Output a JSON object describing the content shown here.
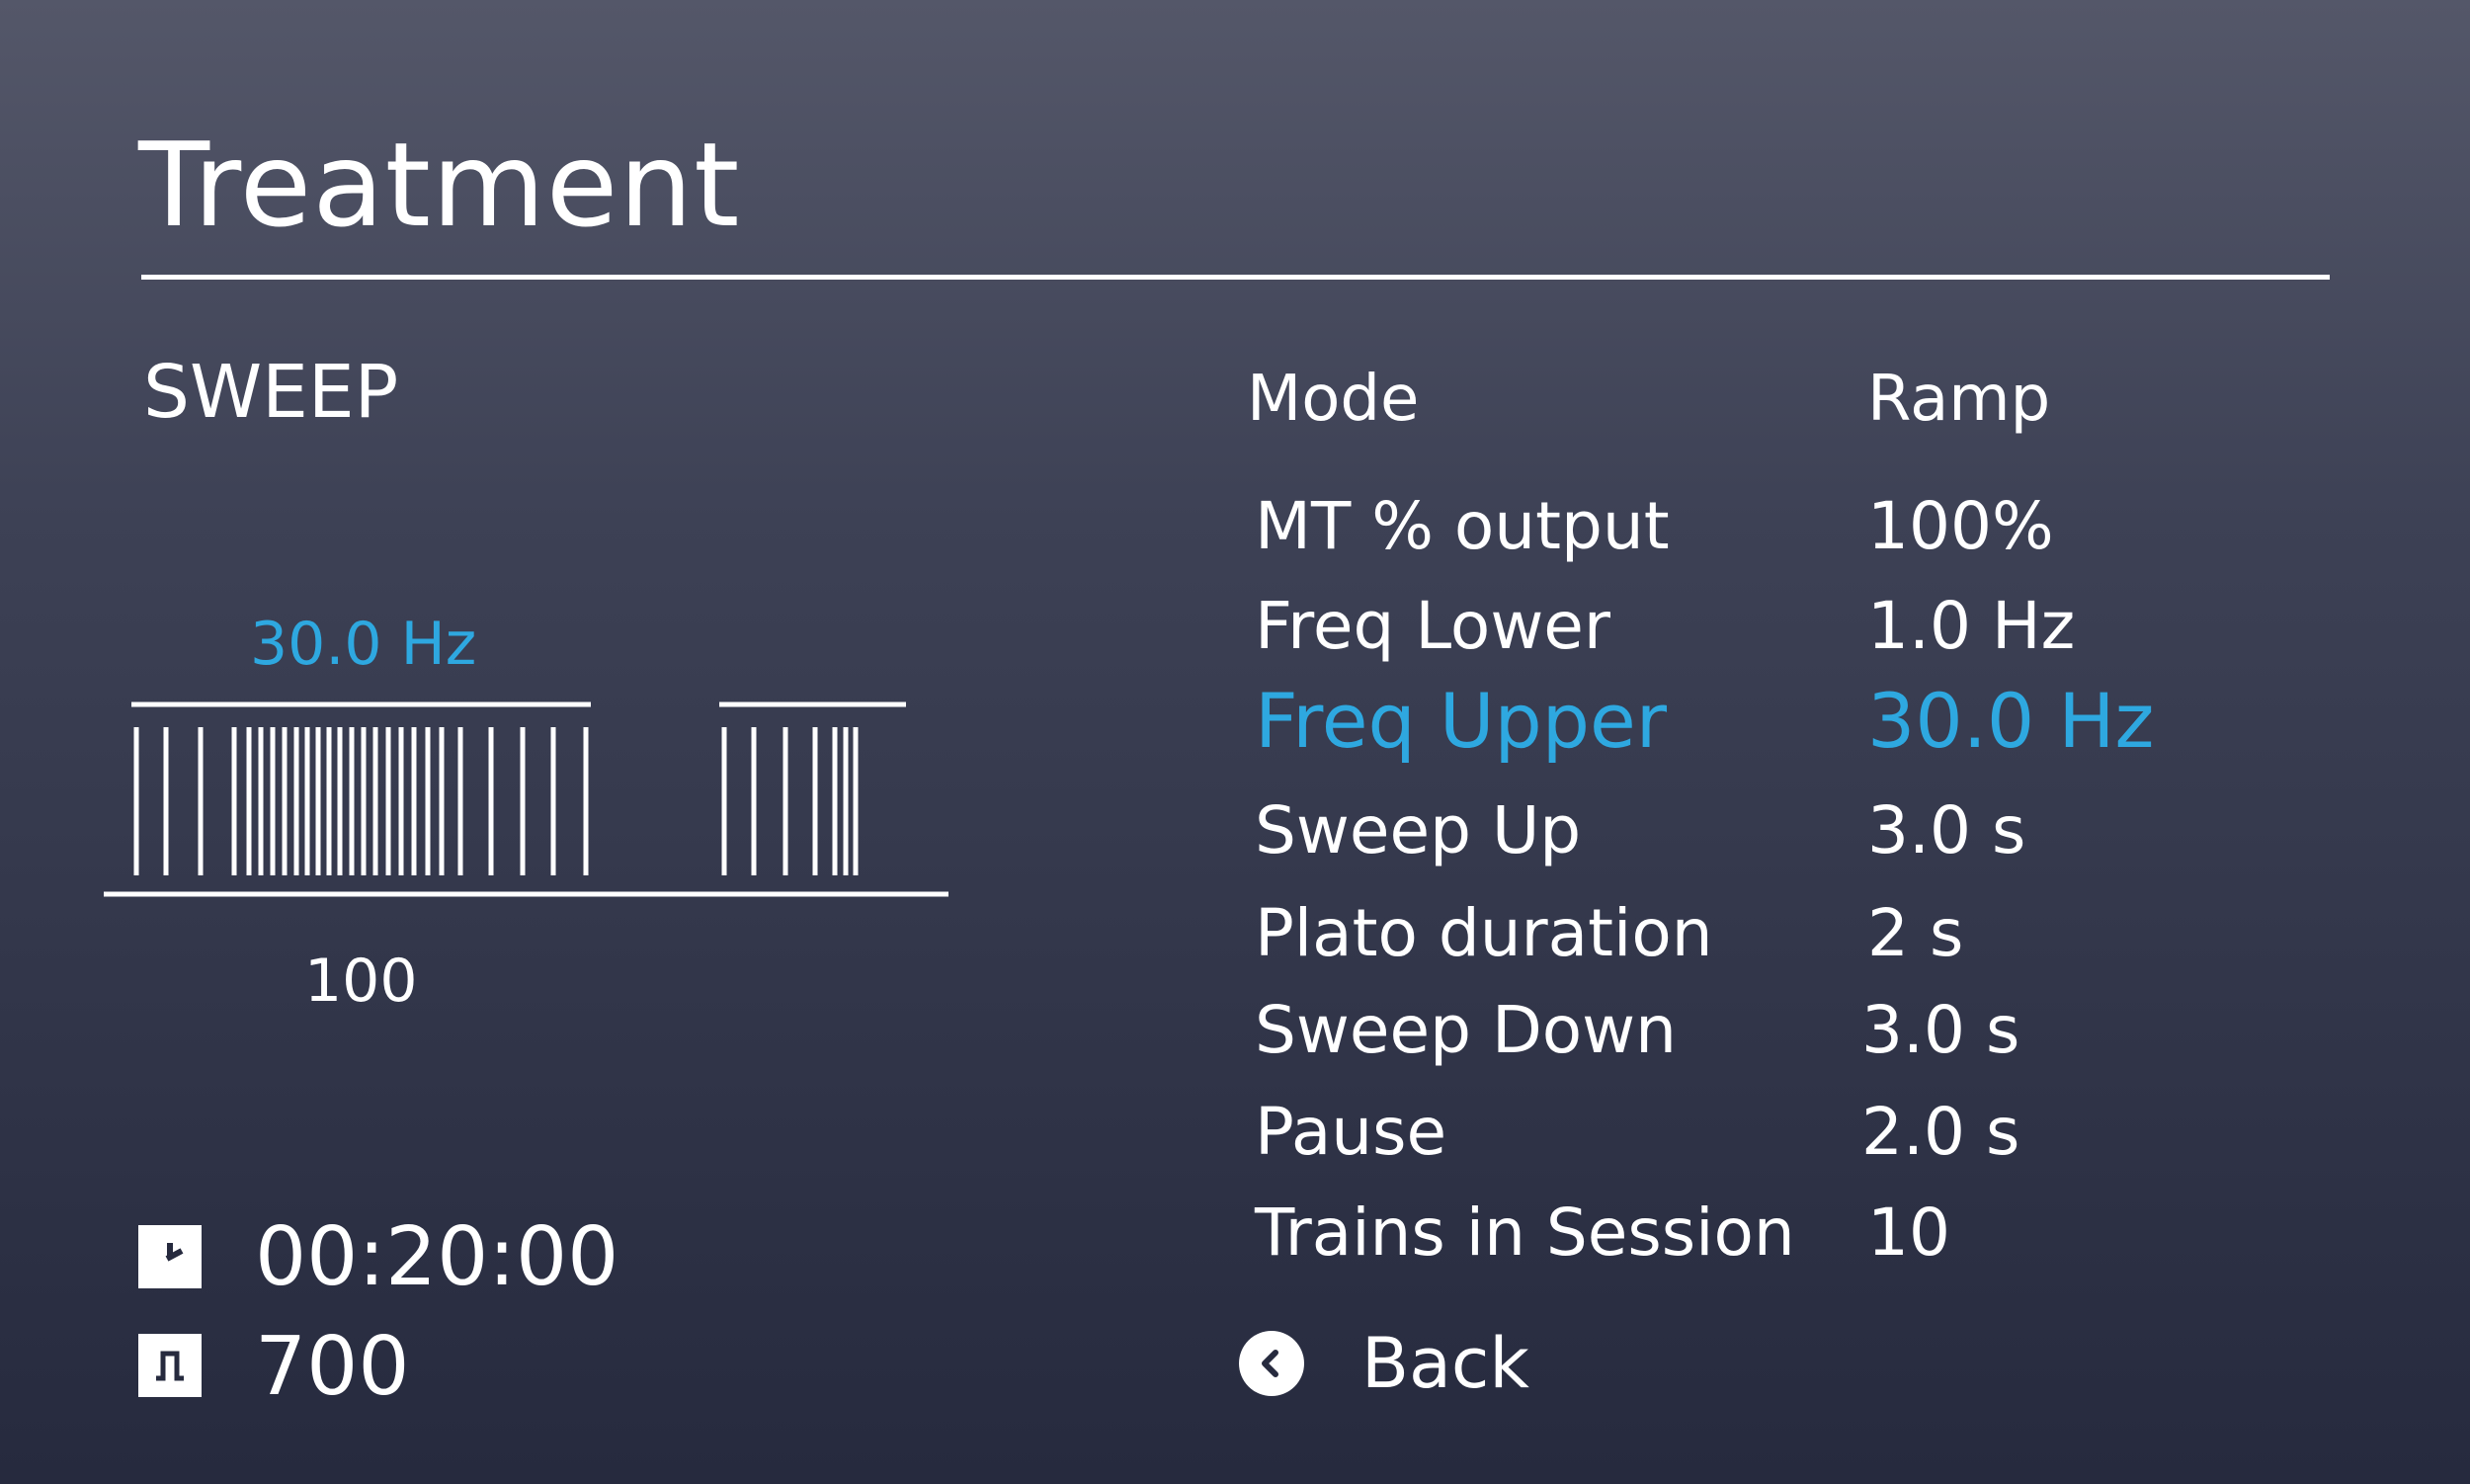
{
  "colors": {
    "accent": "#2ea8e0",
    "text": "#ffffff",
    "background_top": "#545769",
    "background_bottom": "#262a3e"
  },
  "header": {
    "title": "Treatment"
  },
  "program": {
    "name": "SWEEP"
  },
  "sweep_graphic": {
    "frequency_label": "30.0 Hz",
    "intensity_label": "100"
  },
  "params": {
    "mode": {
      "label": "Mode",
      "value": "Ramp"
    },
    "rows": [
      {
        "label": "MT % output",
        "value": "100%",
        "active": false
      },
      {
        "label": "Freq Lower",
        "value": "1.0 Hz",
        "active": false
      },
      {
        "label": "Freq Upper",
        "value": "30.0 Hz",
        "active": true
      },
      {
        "label": "Sweep Up",
        "value": "3.0 s",
        "active": false
      },
      {
        "label": "Plato duration",
        "value": "2 s",
        "active": false
      },
      {
        "label": "Sweep Down",
        "value": "3.0 s",
        "active": false
      },
      {
        "label": "Pause",
        "value": "2.0 s",
        "active": false
      },
      {
        "label": "Trains in Session",
        "value": "10",
        "active": false
      }
    ]
  },
  "session": {
    "time_icon": "clock-icon",
    "time": "00:20:00",
    "pulses_icon": "pulse-icon",
    "pulses": "700"
  },
  "navigation": {
    "back_icon": "chevron-left-icon",
    "back_label": "Back"
  }
}
